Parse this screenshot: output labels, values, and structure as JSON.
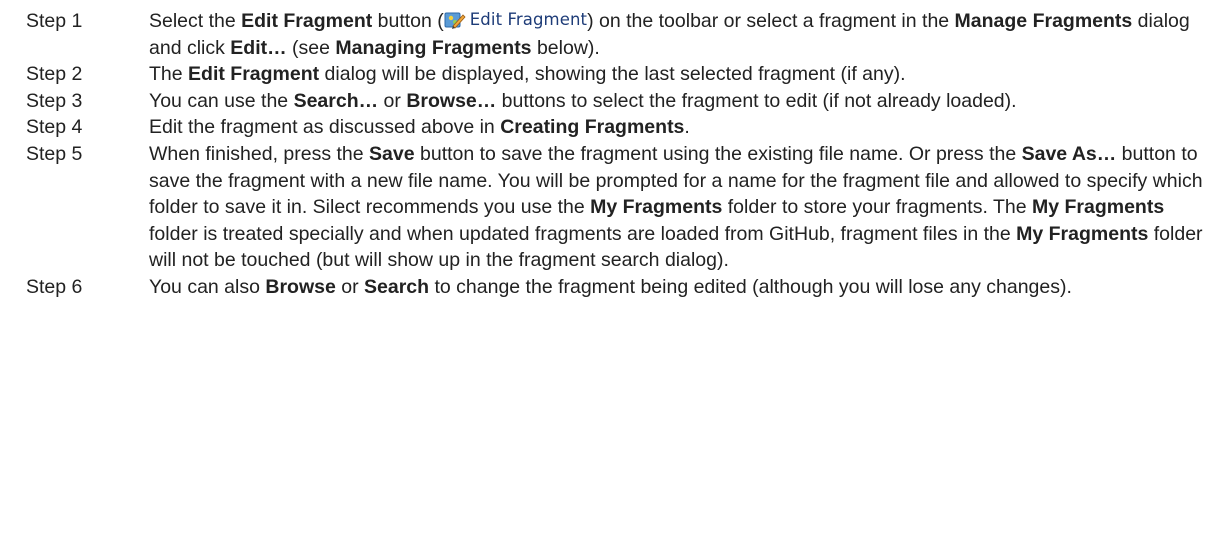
{
  "steps": [
    {
      "label": "Step 1",
      "parts": [
        {
          "t": "Select the "
        },
        {
          "t": "Edit Fragment",
          "b": true
        },
        {
          "t": " button ("
        },
        {
          "icon": "edit-fragment-button-icon",
          "text": "Edit Fragment"
        },
        {
          "t": ") on the toolbar or select a fragment in the "
        },
        {
          "t": "Manage Fragments",
          "b": true
        },
        {
          "t": " dialog and click "
        },
        {
          "t": "Edit…",
          "b": true
        },
        {
          "t": " (see "
        },
        {
          "t": "Managing Fragments",
          "b": true
        },
        {
          "t": " below)."
        }
      ]
    },
    {
      "label": "Step 2",
      "parts": [
        {
          "t": "The "
        },
        {
          "t": "Edit Fragment",
          "b": true
        },
        {
          "t": " dialog will be displayed, showing the last selected fragment (if any)."
        }
      ]
    },
    {
      "label": "Step 3",
      "parts": [
        {
          "t": "You can use the "
        },
        {
          "t": "Search…",
          "b": true
        },
        {
          "t": " or "
        },
        {
          "t": "Browse…",
          "b": true
        },
        {
          "t": " buttons to select the fragment to edit (if not already loaded)."
        }
      ]
    },
    {
      "label": "Step 4",
      "parts": [
        {
          "t": "Edit the fragment as discussed above in "
        },
        {
          "t": "Creating Fragments",
          "b": true
        },
        {
          "t": "."
        }
      ]
    },
    {
      "label": "Step 5",
      "parts": [
        {
          "t": "When finished, press the "
        },
        {
          "t": "Save",
          "b": true
        },
        {
          "t": " button to save the fragment using the existing file name. Or press the "
        },
        {
          "t": "Save As…",
          "b": true
        },
        {
          "t": " button to save the fragment with a new file name. You will be prompted for a name for the fragment file and allowed to specify which folder to save it in. Silect recommends you use the "
        },
        {
          "t": "My Fragments",
          "b": true
        },
        {
          "t": " folder to store your fragments. The "
        },
        {
          "t": "My Fragments",
          "b": true
        },
        {
          "t": " folder is treated specially and when updated fragments are loaded from GitHub, fragment files in the "
        },
        {
          "t": "My Fragments",
          "b": true
        },
        {
          "t": " folder will not be touched (but will show up in the fragment search dialog)."
        }
      ]
    },
    {
      "label": "Step 6",
      "parts": [
        {
          "t": "You can also "
        },
        {
          "t": "Browse",
          "b": true
        },
        {
          "t": " or "
        },
        {
          "t": "Search",
          "b": true
        },
        {
          "t": " to change the fragment being edited (although you will lose any changes)."
        }
      ]
    }
  ]
}
